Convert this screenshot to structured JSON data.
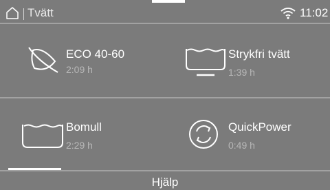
{
  "status": {
    "title": "Tvätt",
    "time": "11:02",
    "home_icon": "home-icon",
    "wifi_icon": "wifi-icon"
  },
  "programs": [
    {
      "name": "ECO 40-60",
      "duration": "2:09 h",
      "icon": "leaf-icon"
    },
    {
      "name": "Strykfri tvätt",
      "duration": "1:39 h",
      "icon": "tub-with-iron-icon"
    },
    {
      "name": "Bomull",
      "duration": "2:29 h",
      "icon": "tub-icon"
    },
    {
      "name": "QuickPower",
      "duration": "0:49 h",
      "icon": "quickpower-icon"
    }
  ],
  "footer": {
    "help_label": "Hjälp"
  },
  "colors": {
    "background": "#7b7b7b",
    "text": "#ffffff",
    "secondary_text": "#b8b8b8",
    "divider": "#a2a2a2"
  }
}
